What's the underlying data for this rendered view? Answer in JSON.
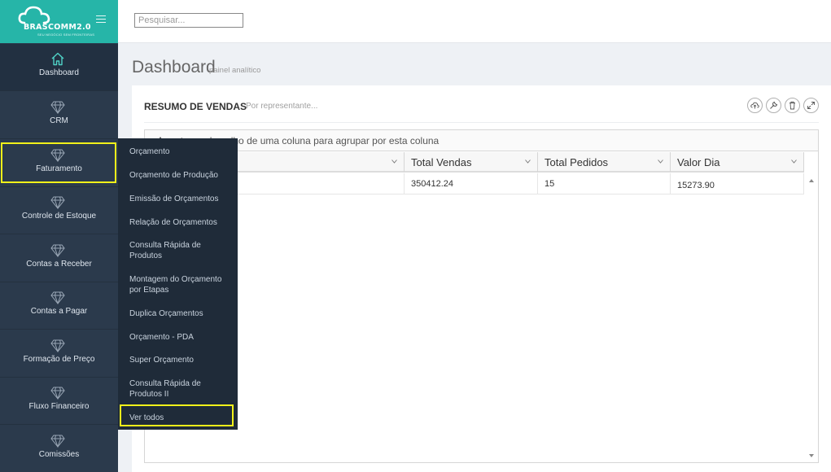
{
  "brand": {
    "name": "BRASCOMM2.0",
    "tagline": "SEU NEGÓCIO SEM FRONTEIRAS"
  },
  "search": {
    "placeholder": "Pesquisar..."
  },
  "sidebar": {
    "items": [
      {
        "label": "Dashboard",
        "icon": "home-icon"
      },
      {
        "label": "CRM",
        "icon": "diamond-icon"
      },
      {
        "label": "Faturamento",
        "icon": "diamond-icon"
      },
      {
        "label": "Controle de Estoque",
        "icon": "diamond-icon"
      },
      {
        "label": "Contas a Receber",
        "icon": "diamond-icon"
      },
      {
        "label": "Contas a Pagar",
        "icon": "diamond-icon"
      },
      {
        "label": "Formação de Preço",
        "icon": "diamond-icon"
      },
      {
        "label": "Fluxo Financeiro",
        "icon": "diamond-icon"
      },
      {
        "label": "Comissões",
        "icon": "diamond-icon"
      }
    ]
  },
  "submenu": {
    "items": [
      "Orçamento",
      "Orçamento de Produção",
      "Emissão de Orçamentos",
      "Relação de Orçamentos",
      "Consulta Rápida de Produtos",
      "Montagem do Orçamento por Etapas",
      "Duplica Orçamentos",
      "Orçamento - PDA",
      "Super Orçamento",
      "Consulta Rápida de Produtos II",
      "Ver todos"
    ]
  },
  "page": {
    "title": "Dashboard",
    "subtitle": "painel analítico"
  },
  "portlet": {
    "title": "RESUMO DE VENDAS",
    "subtitle": "Por representante...",
    "tools": [
      "cloud-upload-icon",
      "wrench-icon",
      "trash-icon",
      "expand-icon"
    ]
  },
  "grid": {
    "group_hint": "Arraste o cabeçalho de uma coluna para agrupar por esta coluna",
    "columns": [
      "",
      "Total Vendas",
      "Total Pedidos",
      "Valor Dia"
    ],
    "rows": [
      [
        "",
        "350412.24",
        "15",
        "15273.90"
      ]
    ]
  },
  "colors": {
    "logo_bg": "#26b5a8",
    "sidebar_bg": "#2b3a4c",
    "submenu_bg": "#1f2b39",
    "highlight": "#f1f11a"
  }
}
